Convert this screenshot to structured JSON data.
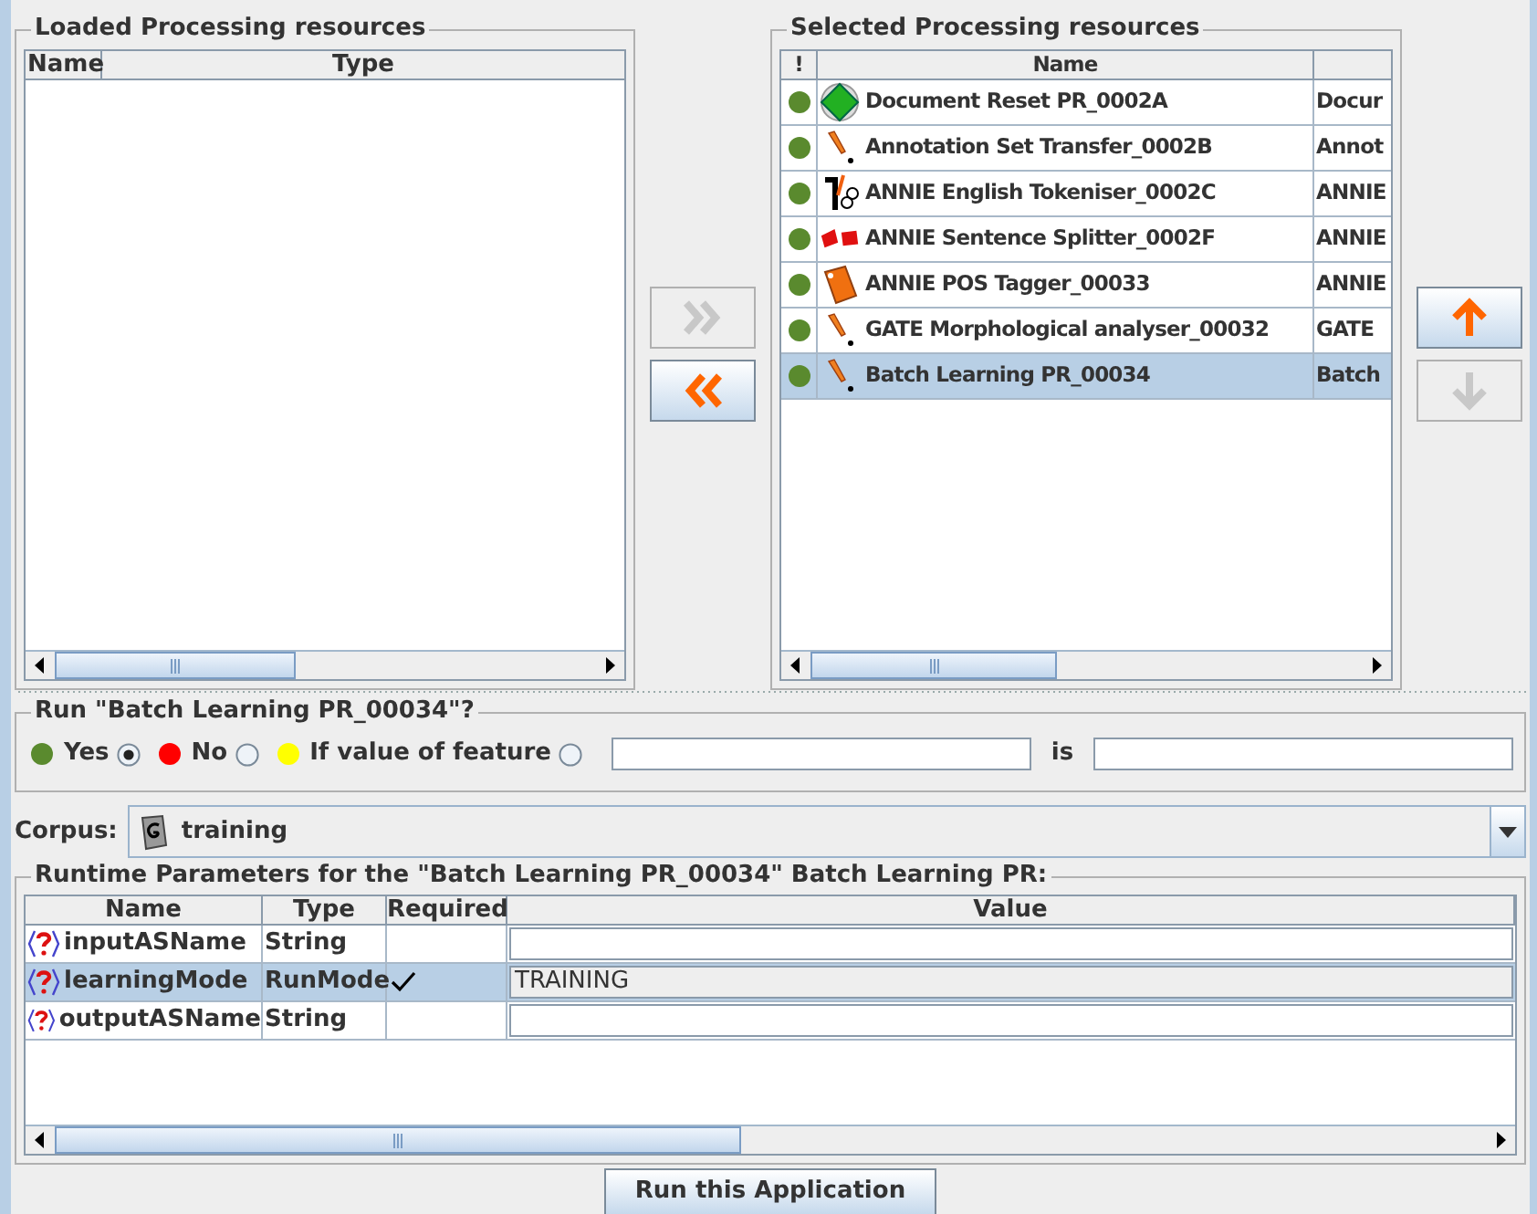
{
  "loaded_panel": {
    "title": "Loaded Processing resources",
    "columns": [
      "Name",
      "Type"
    ]
  },
  "transfer_buttons": [
    {
      "kind": "add",
      "disabled": true
    },
    {
      "kind": "remove",
      "disabled": false
    }
  ],
  "selected_panel": {
    "title": "Selected Processing resources",
    "columns": [
      "!",
      "Name"
    ],
    "rows": [
      {
        "kind": "reset",
        "name": "Document Reset PR_0002A",
        "type": "Docur",
        "selected": false
      },
      {
        "kind": "tool",
        "name": "Annotation Set Transfer_0002B",
        "type": "Annot",
        "selected": false
      },
      {
        "kind": "tokeniser",
        "name": "ANNIE English Tokeniser_0002C",
        "type": "ANNIE",
        "selected": false
      },
      {
        "kind": "splitter",
        "name": "ANNIE Sentence Splitter_0002F",
        "type": "ANNIE",
        "selected": false
      },
      {
        "kind": "tagger",
        "name": "ANNIE POS Tagger_00033",
        "type": "ANNIE",
        "selected": false
      },
      {
        "kind": "tool",
        "name": "GATE Morphological analyser_00032",
        "type": "GATE",
        "selected": false
      },
      {
        "kind": "tool",
        "name": "Batch Learning PR_00034",
        "type": "Batch",
        "selected": true
      }
    ]
  },
  "order_buttons": [
    {
      "kind": "up",
      "disabled": false
    },
    {
      "kind": "down",
      "disabled": true
    }
  ],
  "run_condition": {
    "title": "Run \"Batch Learning PR_00034\"?",
    "options": [
      {
        "label": "Yes",
        "color": "#5a8a2e",
        "selected": true
      },
      {
        "label": "No",
        "color": "#ff0000",
        "selected": false
      },
      {
        "label": "If value of feature",
        "color": "#ffff00",
        "selected": false
      }
    ],
    "is_label": "is"
  },
  "corpus": {
    "label": "Corpus:",
    "value": "training"
  },
  "runtime_parameters": {
    "title": "Runtime Parameters for the \"Batch Learning PR_00034\" Batch Learning PR:",
    "columns": [
      "Name",
      "Type",
      "Required",
      "Value"
    ],
    "rows": [
      {
        "name": "inputASName",
        "type": "String",
        "required": false,
        "value": null,
        "selected": false
      },
      {
        "name": "learningMode",
        "type": "RunMode",
        "required": true,
        "value": "TRAINING",
        "selected": true
      },
      {
        "name": "outputASName",
        "type": "String",
        "required": false,
        "value": null,
        "selected": false
      }
    ]
  },
  "run_button": "Run this Application"
}
